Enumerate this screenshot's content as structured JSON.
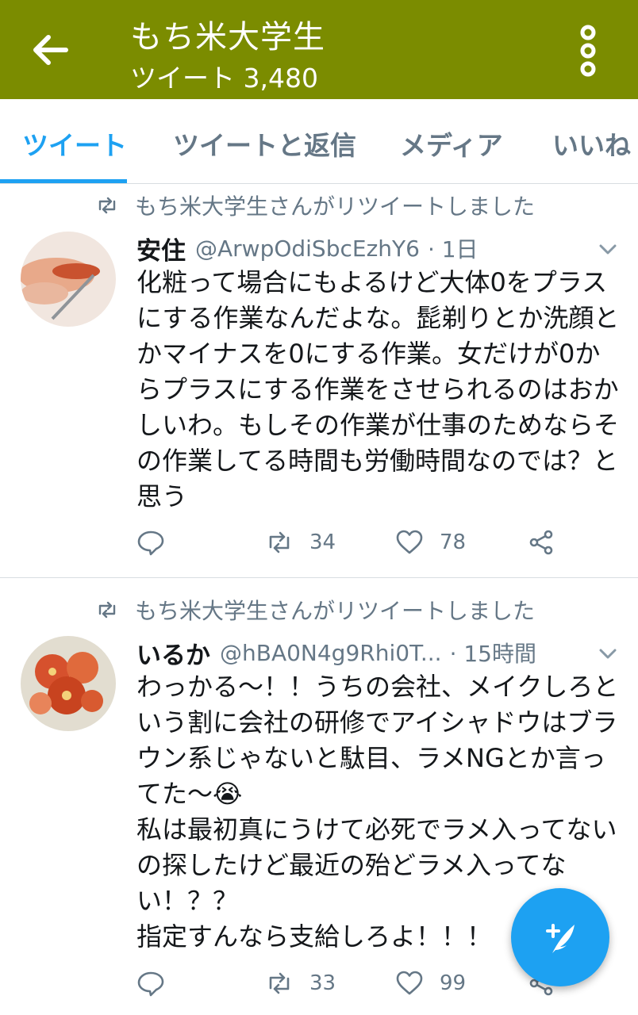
{
  "appbar": {
    "title": "もち米大学生",
    "subtitle": "ツイート 3,480",
    "back_icon": "back-arrow-icon",
    "more_icon": "more-vertical-icon",
    "color": "#7b8c00"
  },
  "tabs": [
    {
      "label": "ツイート",
      "active": true
    },
    {
      "label": "ツイートと返信",
      "active": false
    },
    {
      "label": "メディア",
      "active": false
    },
    {
      "label": "いいね",
      "active": false
    }
  ],
  "tweets": [
    {
      "retweet_label": "もち米大学生さんがリツイートしました",
      "name": "安住",
      "handle": "@ArwpOdiSbcEzhY6",
      "time": "· 1日",
      "text": "化粧って場合にもよるけど大体0をプラスにする作業なんだよな。髭剃りとか洗顔とかマイナスを0にする作業。女だけが0からプラスにする作業をさせられるのはおかしいわ。もしその作業が仕事のためならその作業してる時間も労働時間なのでは？と思う",
      "replies": "",
      "retweets": "34",
      "likes": "78"
    },
    {
      "retweet_label": "もち米大学生さんがリツイートしました",
      "name": "いるか",
      "handle": "@hBA0N4g9Rhi0T...",
      "time": "· 15時間",
      "text": "わっかる〜！！うちの会社、メイクしろという割に会社の研修でアイシャドウはブラウン系じゃないと駄目、ラメNGとか言ってた〜😭\n私は最初真にうけて必死でラメ入ってないの探したけど最近の殆どラメ入ってない！？？\n指定すんなら支給しろよ！！！",
      "replies": "",
      "retweets": "33",
      "likes": "99"
    }
  ],
  "fab": {
    "icon": "compose-tweet-icon",
    "color": "#1da1f2"
  },
  "colors": {
    "accent": "#1da1f2",
    "secondary_text": "#657786"
  }
}
